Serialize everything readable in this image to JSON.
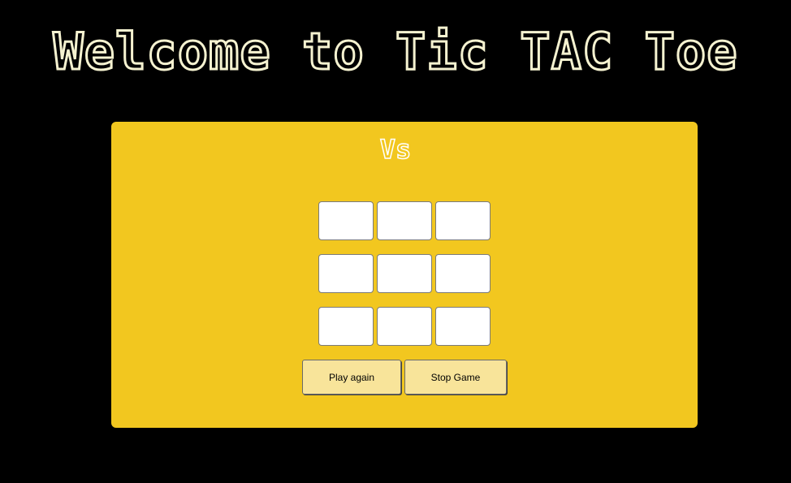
{
  "header": {
    "title": "Welcome to Tic TAC Toe"
  },
  "game": {
    "vs_label": "Vs",
    "board": [
      [
        "",
        "",
        ""
      ],
      [
        "",
        "",
        ""
      ],
      [
        "",
        "",
        ""
      ]
    ]
  },
  "controls": {
    "play_again_label": "Play again",
    "stop_game_label": "Stop Game"
  },
  "colors": {
    "background": "#000000",
    "panel": "#f2c71f",
    "title_outline": "#f5f2d0",
    "button": "#f8e49a",
    "cell": "#ffffff"
  }
}
